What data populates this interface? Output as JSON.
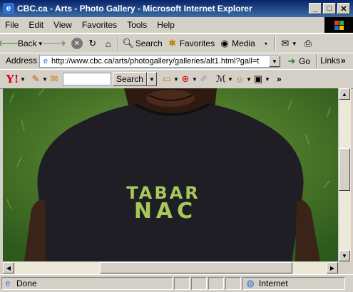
{
  "window": {
    "title": "CBC.ca - Arts - Photo Gallery - Microsoft Internet Explorer"
  },
  "menu": [
    "File",
    "Edit",
    "View",
    "Favorites",
    "Tools",
    "Help"
  ],
  "toolbar": {
    "back": "Back",
    "search": "Search",
    "favorites": "Favorites",
    "media": "Media"
  },
  "address": {
    "label": "Address",
    "url": "http://www.cbc.ca/arts/photogallery/galleries/alt1.html?gall=t",
    "go": "Go",
    "links": "Links"
  },
  "yahoo": {
    "logo": "Y!",
    "search_button": "Search",
    "search_value": ""
  },
  "photo": {
    "shirt_text_line1": "TABAR",
    "shirt_text_line2": "NAC"
  },
  "status": {
    "text": "Done",
    "zone": "Internet"
  },
  "colors": {
    "titlebar": "#0a246a",
    "chrome": "#d4d0c8",
    "grass": "#3d6a24",
    "shirt": "#1e1e24",
    "shirt_text": "#a7c85a",
    "skin": "#3a2418"
  }
}
